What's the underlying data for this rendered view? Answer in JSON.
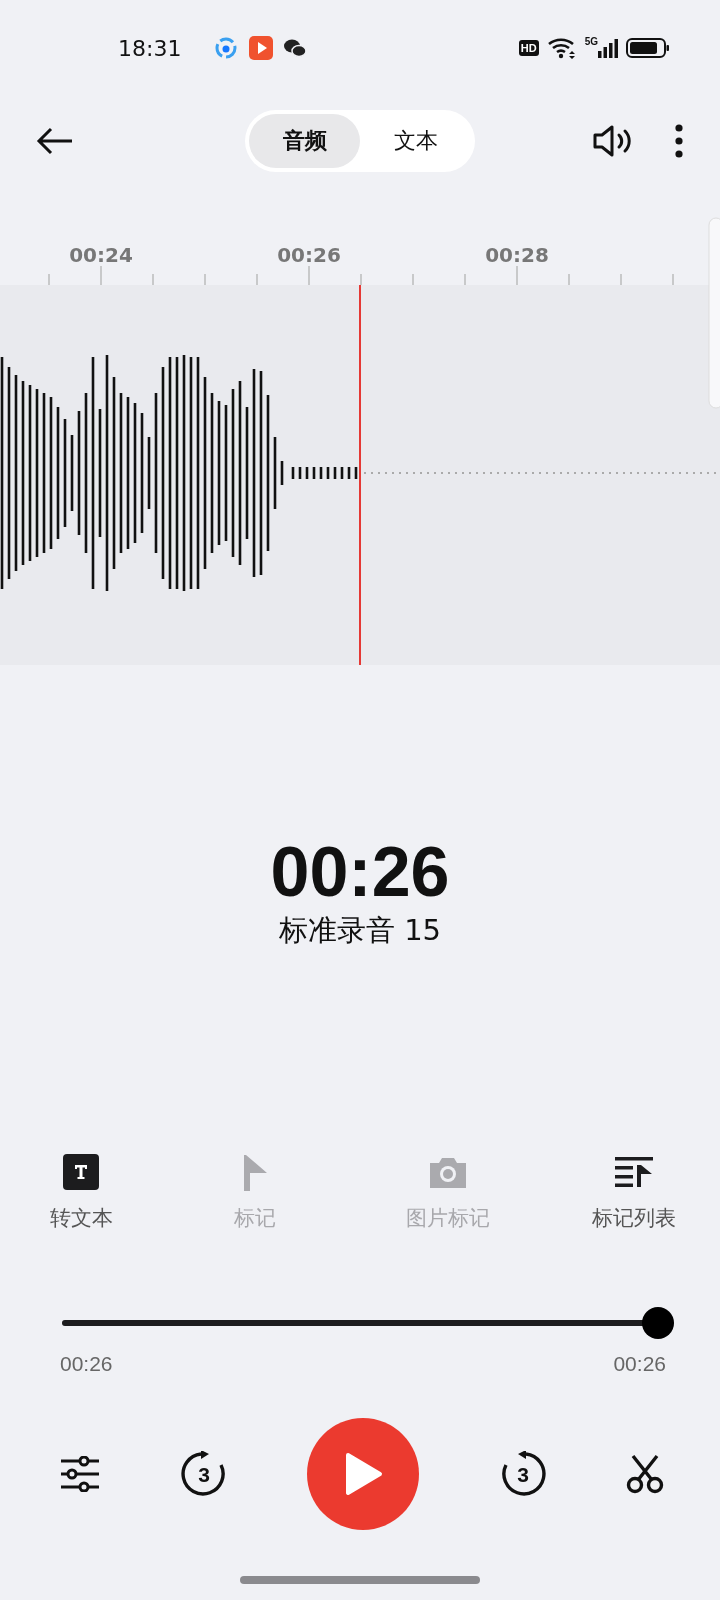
{
  "status_bar": {
    "time": "18:31",
    "hd_badge": "HD",
    "network_label": "5G"
  },
  "header": {
    "tabs": [
      {
        "label": "音频",
        "selected": true
      },
      {
        "label": "文本",
        "selected": false
      }
    ]
  },
  "timeline": {
    "ticks": [
      "00:24",
      "00:26",
      "00:28"
    ]
  },
  "recording": {
    "elapsed": "00:26",
    "name": "标准录音 15"
  },
  "tools": [
    {
      "label": "转文本",
      "kind": "text",
      "disabled": false
    },
    {
      "label": "标记",
      "kind": "flag",
      "disabled": true
    },
    {
      "label": "图片标记",
      "kind": "camera",
      "disabled": true
    },
    {
      "label": "标记列表",
      "kind": "list",
      "disabled": false
    }
  ],
  "progress": {
    "level": 1,
    "current": "00:26",
    "total": "00:26"
  },
  "controls": {
    "rewind_label": "3",
    "forward_label": "3"
  }
}
